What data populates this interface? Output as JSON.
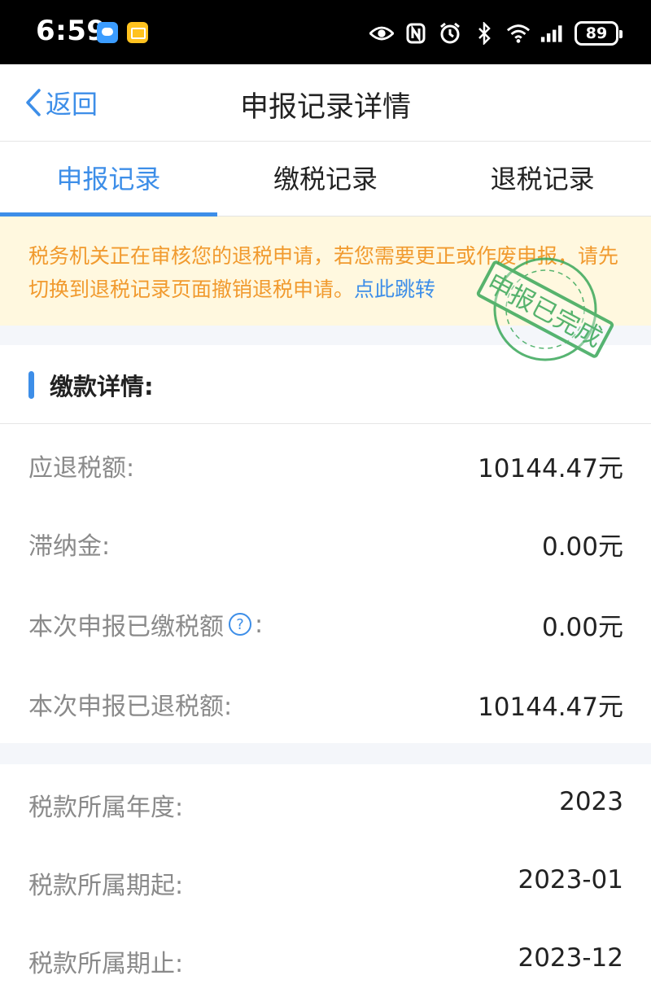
{
  "status_bar": {
    "time": "6:59",
    "battery": "89",
    "icons": [
      "chat-app-icon",
      "mail-app-icon",
      "eye-icon",
      "nfc-icon",
      "alarm-icon",
      "bluetooth-icon",
      "wifi-icon",
      "signal-icon",
      "battery-icon"
    ]
  },
  "nav": {
    "back_label": "返回",
    "title": "申报记录详情"
  },
  "tabs": [
    {
      "label": "申报记录",
      "active": true
    },
    {
      "label": "缴税记录",
      "active": false
    },
    {
      "label": "退税记录",
      "active": false
    }
  ],
  "notice": {
    "text": "税务机关正在审核您的退税申请，若您需要更正或作废申报，请先切换到退税记录页面撤销退税申请。",
    "link": "点此跳转"
  },
  "stamp": {
    "text": "申报已完成",
    "color": "#3aa85a"
  },
  "payment": {
    "title": "缴款详情:",
    "rows": [
      {
        "label": "应退税额:",
        "value": "10144.47元"
      },
      {
        "label": "滞纳金:",
        "value": "0.00元"
      },
      {
        "label": "本次申报已缴税额",
        "suffix": ":",
        "value": "0.00元"
      },
      {
        "label": "本次申报已退税额:",
        "value": "10144.47元"
      }
    ]
  },
  "period": {
    "rows": [
      {
        "label": "税款所属年度:",
        "value": "2023"
      },
      {
        "label": "税款所属期起:",
        "value": "2023-01"
      },
      {
        "label": "税款所属期止:",
        "value": "2023-12"
      }
    ]
  },
  "colors": {
    "accent": "#3d8ee8",
    "notice_text": "#f19a2e",
    "notice_bg": "#fff8df"
  }
}
